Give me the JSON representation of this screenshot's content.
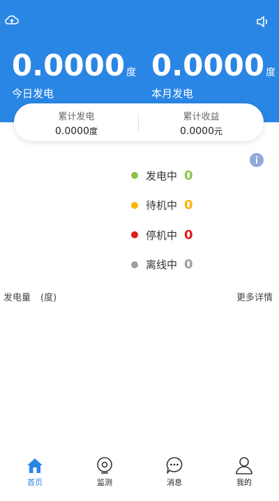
{
  "header": {
    "today": {
      "value": "0.0000",
      "unit": "度",
      "label": "今日发电"
    },
    "month": {
      "value": "0.0000",
      "unit": "度",
      "label": "本月发电"
    }
  },
  "totals": {
    "generation": {
      "label": "累计发电",
      "value": "0.0000",
      "unit": "度"
    },
    "income": {
      "label": "累计收益",
      "value": "0.0000",
      "unit": "元"
    }
  },
  "status": [
    {
      "name": "发电中",
      "count": "0",
      "color": "#8bc34a"
    },
    {
      "name": "待机中",
      "count": "0",
      "color": "#ffb300"
    },
    {
      "name": "停机中",
      "count": "0",
      "color": "#e21b1b"
    },
    {
      "name": "离线中",
      "count": "0",
      "color": "#9e9e9e"
    }
  ],
  "chart": {
    "title": "发电量",
    "unit": "(度)",
    "more": "更多详情"
  },
  "tabs": [
    {
      "label": "首页",
      "icon": "home-icon"
    },
    {
      "label": "监测",
      "icon": "monitor-icon"
    },
    {
      "label": "消息",
      "icon": "message-icon"
    },
    {
      "label": "我的",
      "icon": "user-icon"
    }
  ],
  "colors": {
    "primary": "#2a86e4"
  }
}
